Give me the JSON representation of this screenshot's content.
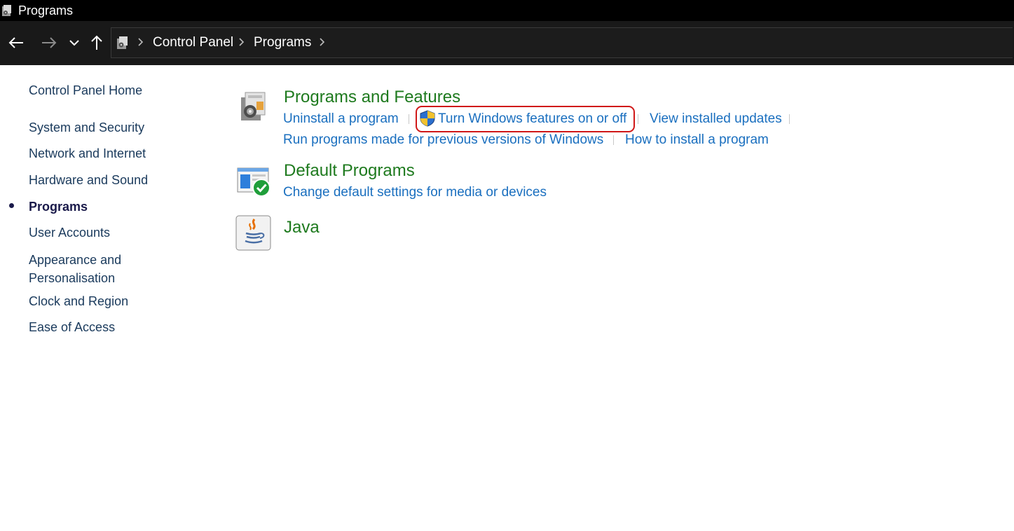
{
  "window": {
    "title": "Programs"
  },
  "addressbar": {
    "breadcrumbs": [
      "Control Panel",
      "Programs"
    ]
  },
  "sidebar": {
    "home": "Control Panel Home",
    "items": [
      {
        "label": "System and Security"
      },
      {
        "label": "Network and Internet"
      },
      {
        "label": "Hardware and Sound"
      },
      {
        "label": "Programs",
        "current": true
      },
      {
        "label": "User Accounts"
      },
      {
        "label": "Appearance and Personalisation",
        "lines": [
          "Appearance and",
          "Personalisation"
        ]
      },
      {
        "label": "Clock and Region"
      },
      {
        "label": "Ease of Access"
      }
    ]
  },
  "main": {
    "categories": [
      {
        "title": "Programs and Features",
        "icon": "programs-features-icon",
        "links": [
          "Uninstall a program",
          "Turn Windows features on or off",
          "View installed updates",
          "Run programs made for previous versions of Windows",
          "How to install a program"
        ]
      },
      {
        "title": "Default Programs",
        "icon": "default-programs-icon",
        "links": [
          "Change default settings for media or devices"
        ]
      },
      {
        "title": "Java",
        "icon": "java-icon",
        "links": []
      }
    ]
  },
  "colors": {
    "titlebar_bg": "#000000",
    "navbar_bg": "#191919",
    "category_title": "#1e7a1e",
    "link": "#1a6fbf",
    "highlight": "#d01818"
  }
}
